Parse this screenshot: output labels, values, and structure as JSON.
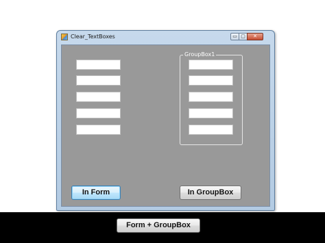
{
  "window": {
    "title": "Clear_TextBoxes",
    "caption_buttons": {
      "minimize": "▭",
      "maximize": "▢",
      "close": "✕"
    }
  },
  "form_textboxes": [
    "",
    "",
    "",
    "",
    ""
  ],
  "groupbox": {
    "title": "GroupBox1",
    "textboxes": [
      "",
      "",
      "",
      "",
      ""
    ]
  },
  "buttons": {
    "in_form": "In Form",
    "in_groupbox": "In GroupBox",
    "form_groupbox": "Form + GroupBox"
  },
  "colors": {
    "client_background": "#999999",
    "focused_button_border": "#3c7fb1"
  }
}
